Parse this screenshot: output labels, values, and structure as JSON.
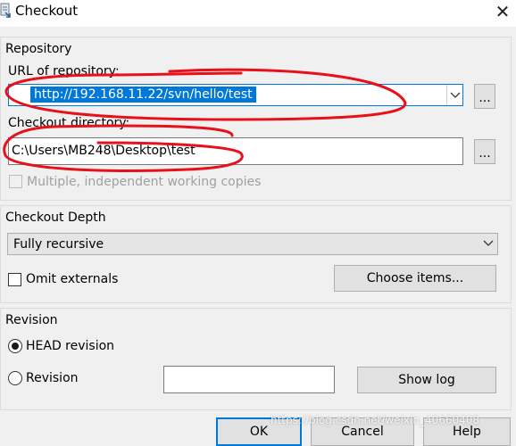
{
  "window": {
    "title": "Checkout",
    "close_symbol": "✕",
    "icon": "svn-checkout-icon"
  },
  "repository": {
    "group_label": "Repository",
    "url_label": "URL of repository:",
    "url_value": "http://192.168.11.22/svn/hello/test",
    "dir_label": "Checkout directory:",
    "dir_value": "C:\\Users\\MB248\\Desktop\\test",
    "browse_label": "...",
    "multiple_label": "Multiple, independent working copies"
  },
  "checkout_depth": {
    "group_label": "Checkout Depth",
    "depth_value": "Fully recursive",
    "omit_externals_label": "Omit externals",
    "choose_items_label": "Choose items..."
  },
  "revision": {
    "group_label": "Revision",
    "head_label": "HEAD revision",
    "revision_label": "Revision",
    "revision_value": "",
    "show_log_label": "Show log",
    "selected": "head"
  },
  "footer": {
    "ok_label": "OK",
    "cancel_label": "Cancel",
    "help_label": "Help"
  },
  "watermark": "https://blog.csdn.net/weixin_40660408",
  "colors": {
    "accent": "#0078d7",
    "annotation_red": "#e8101a",
    "window_bg": "#f0f0f0"
  }
}
